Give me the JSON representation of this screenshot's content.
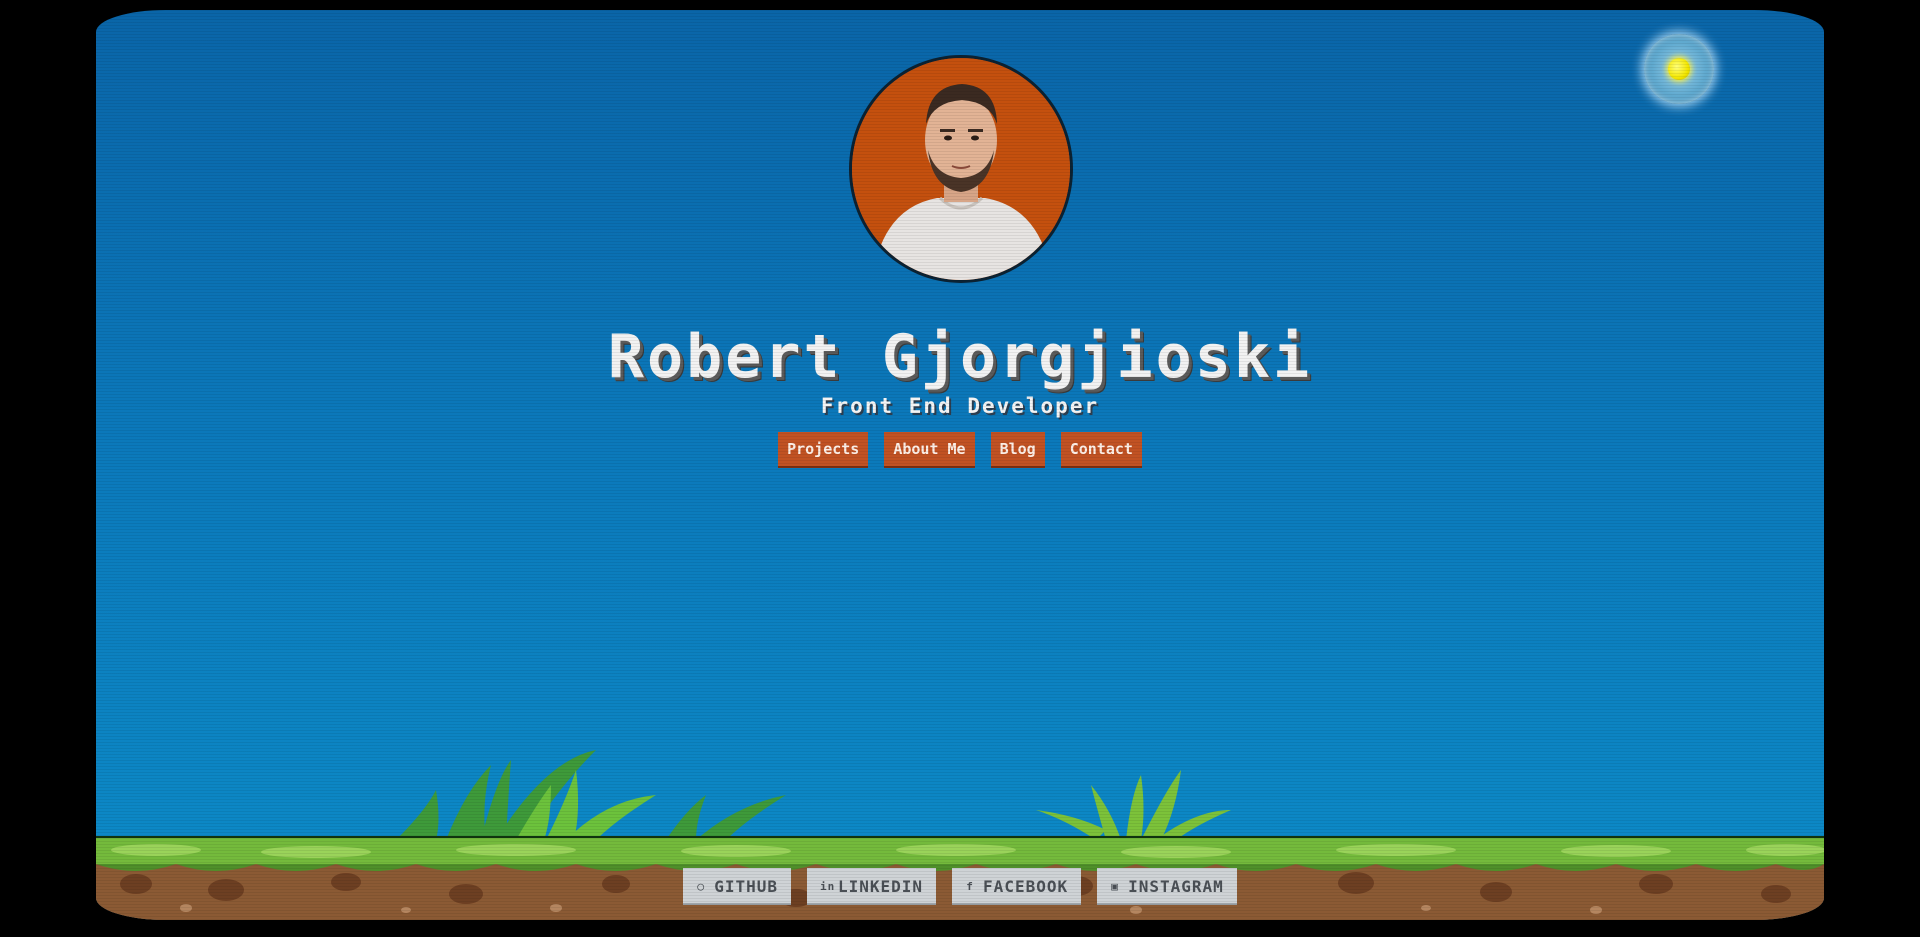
{
  "profile": {
    "name": "Robert Gjorgjioski",
    "role": "Front End Developer"
  },
  "nav": {
    "items": [
      {
        "label": "Projects"
      },
      {
        "label": "About Me"
      },
      {
        "label": "Blog"
      },
      {
        "label": "Contact"
      }
    ]
  },
  "socials": {
    "items": [
      {
        "label": "GITHUB",
        "icon": "github-icon"
      },
      {
        "label": "LINKEDIN",
        "icon": "linkedin-icon"
      },
      {
        "label": "FACEBOOK",
        "icon": "facebook-icon"
      },
      {
        "label": "INSTAGRAM",
        "icon": "instagram-icon"
      }
    ]
  },
  "theme_toggle": {
    "icon": "sun-icon"
  },
  "colors": {
    "sky": "#0b78ba",
    "nav_button": "#c15223",
    "social_button": "#cfd3d6",
    "avatar_background": "#c4500e",
    "grass": "#6fb63a",
    "dirt": "#8b5a34"
  }
}
